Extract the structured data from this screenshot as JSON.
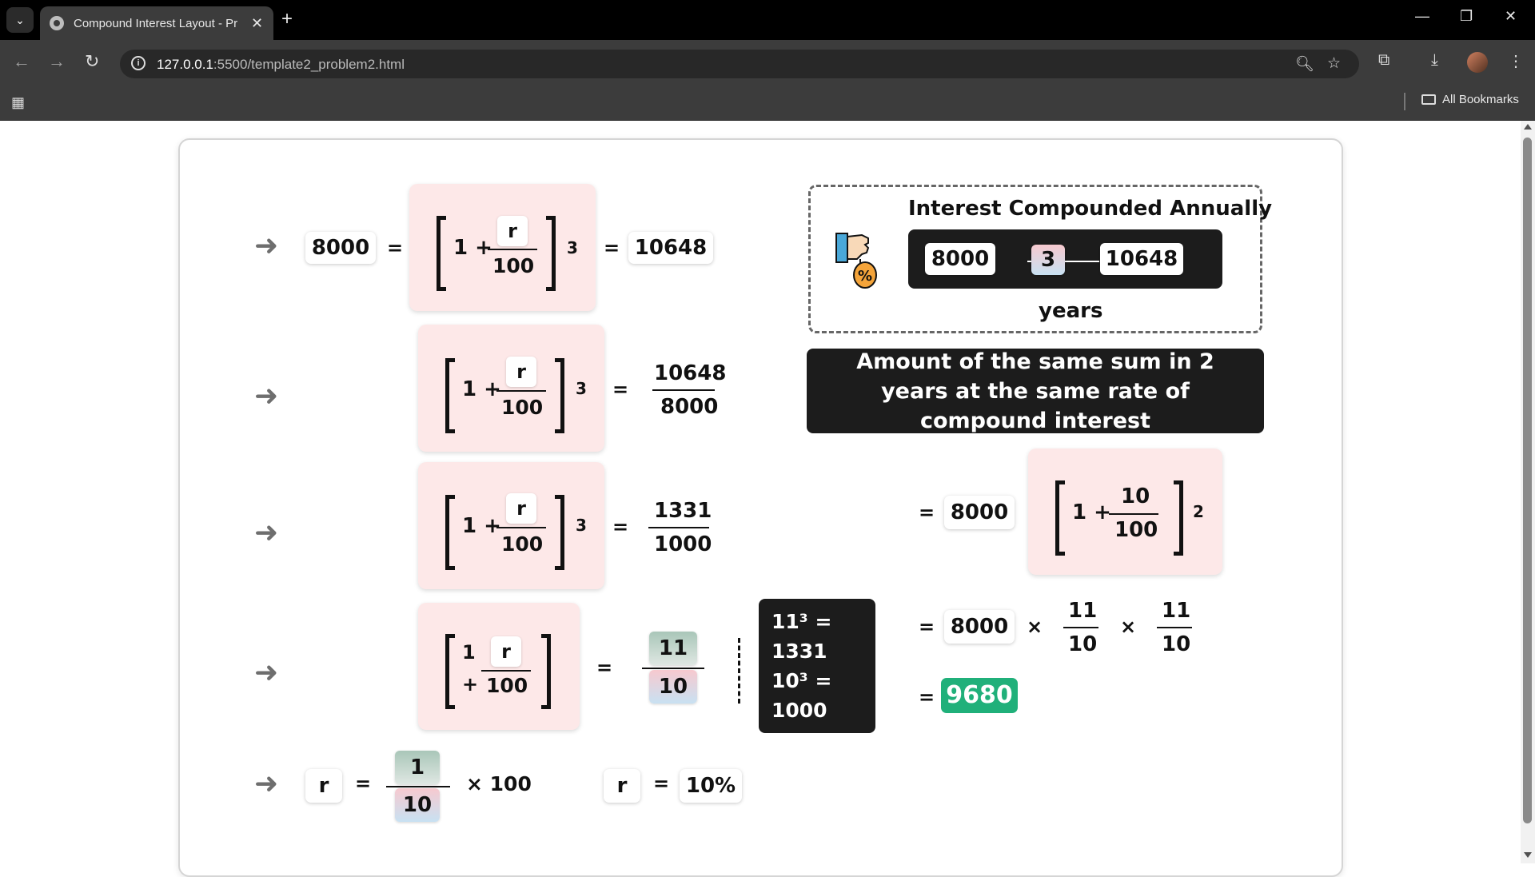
{
  "browser": {
    "tab_title": "Compound Interest Layout - Pr",
    "url_host": "127.0.0.1",
    "url_path": ":5500/template2_problem2.html",
    "bookmarks_label": "All Bookmarks"
  },
  "row1": {
    "principal": "8000",
    "equals": "=",
    "one_plus": "1 +",
    "r": "r",
    "hundred": "100",
    "exponent": "3",
    "amount": "10648"
  },
  "row2": {
    "one_plus": "1 +",
    "r": "r",
    "hundred": "100",
    "exponent": "3",
    "equals": "=",
    "num": "10648",
    "den": "8000"
  },
  "row3": {
    "one_plus": "1 +",
    "r": "r",
    "hundred": "100",
    "exponent": "3",
    "equals": "=",
    "num": "1331",
    "den": "1000"
  },
  "row4": {
    "one": "1",
    "plus": "+",
    "r": "r",
    "hundred": "100",
    "equals": "=",
    "num": "11",
    "den": "10"
  },
  "row5": {
    "r": "r",
    "equals": "=",
    "num": "1",
    "den": "10",
    "times100": "× 100",
    "r2": "r",
    "equals2": "=",
    "result": "10%"
  },
  "note_box": {
    "line1": "11³ =",
    "line2": "1331",
    "line3": "10³ =",
    "line4": "1000"
  },
  "info": {
    "title": "Interest Compounded Annually",
    "start": "8000",
    "years": "3",
    "end": "10648",
    "years_label": "years",
    "icon": "hand-percent-icon"
  },
  "question": {
    "text": "Amount of the same sum in 2 years at the same rate of compound interest"
  },
  "answer": {
    "eq1": "=",
    "principal1": "8000",
    "one_plus": "1 +",
    "ten": "10",
    "hundred": "100",
    "exponent": "2",
    "eq2": "=",
    "principal2": "8000",
    "times1": "×",
    "f1_num": "11",
    "f1_den": "10",
    "times2": "×",
    "f2_num": "11",
    "f2_den": "10",
    "eq3": "=",
    "final": "9680"
  },
  "colors": {
    "accent_green": "#20b07a",
    "pink_box": "#fde8e8",
    "dark_box": "#1c1c1c"
  }
}
